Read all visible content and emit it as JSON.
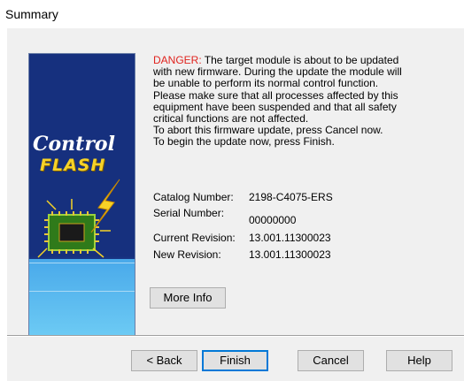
{
  "window": {
    "title": "Summary"
  },
  "banner": {
    "logo_line1": "Control",
    "logo_line2": "FLASH"
  },
  "message": {
    "danger_label": "DANGER:",
    "line1_rest": " The target module is about to be updated",
    "lines": [
      "with new firmware. During the update the module will",
      "be unable to perform its normal control function.",
      "Please make sure that all processes affected by this",
      "equipment have been suspended and that all safety",
      "critical functions are not affected.",
      "To abort this firmware update, press Cancel now.",
      "To begin the update now, press Finish."
    ]
  },
  "details": {
    "catalog_label": "Catalog Number:",
    "catalog_value": "2198-C4075-ERS",
    "serial_label": "Serial Number:",
    "serial_value": "00000000",
    "current_label": "Current Revision:",
    "current_value": "13.001.11300023",
    "new_label": "New Revision:",
    "new_value": "13.001.11300023"
  },
  "buttons": {
    "more_info": "More Info",
    "back": "< Back",
    "finish": "Finish",
    "cancel": "Cancel",
    "help": "Help"
  },
  "colors": {
    "danger": "#e0231e",
    "accent": "#0078d7",
    "banner_dark": "#16307e",
    "banner_light": "#5fbdf0"
  }
}
